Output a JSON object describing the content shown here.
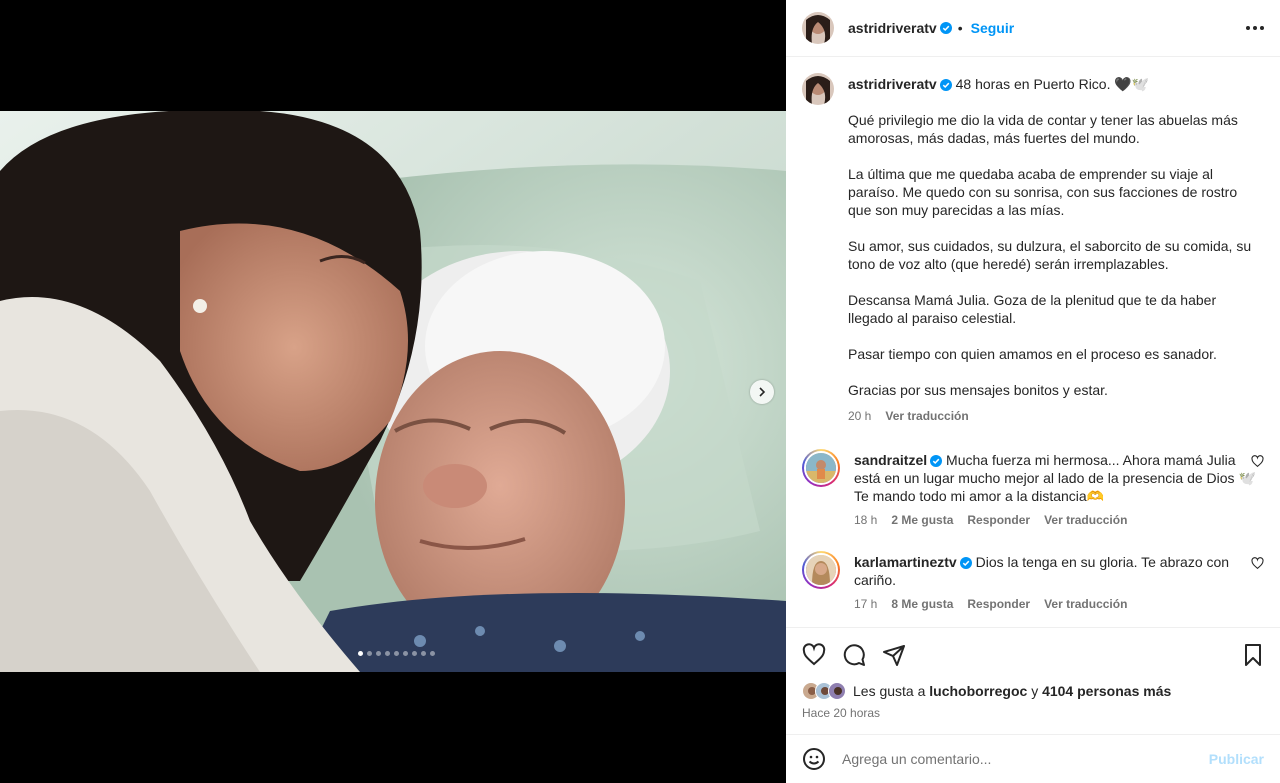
{
  "post": {
    "author": "astridriveratv",
    "follow_label": "Seguir",
    "separator": "•",
    "caption_lines": [
      "48 horas en Puerto Rico. 🖤🕊️",
      "Qué privilegio me dio la vida de contar y tener las abuelas más amorosas, más dadas, más fuertes del mundo.",
      "La última que me quedaba acaba de emprender su viaje al paraíso. Me quedo con su sonrisa, con sus facciones de rostro que son muy parecidas a las mías.",
      "Su amor, sus cuidados, su dulzura, el saborcito de su comida, su tono de voz alto (que heredé) serán irremplazables.",
      "Descansa Mamá Julia. Goza de la plenitud que te da haber llegado al paraiso celestial.",
      "Pasar tiempo con quien amamos en el proceso es sanador.",
      "Gracias por sus mensajes bonitos y estar."
    ],
    "caption_time": "20 h",
    "translate_label": "Ver traducción"
  },
  "comments": [
    {
      "user": "sandraitzel",
      "text": "Mucha fuerza mi hermosa... Ahora mamá Julia está en un lugar mucho mejor al lado de la presencia de Dios 🕊️ Te mando todo mi amor a la distancia🫶",
      "time": "18 h",
      "likes": "2 Me gusta",
      "reply": "Responder",
      "translate": "Ver traducción"
    },
    {
      "user": "karlamartineztv",
      "text": "Dios la tenga en su gloria. Te abrazo con cariño.",
      "time": "17 h",
      "likes": "8 Me gusta",
      "reply": "Responder",
      "translate": "Ver traducción"
    }
  ],
  "engagement": {
    "likes_prefix": "Les gusta a",
    "liked_by": "luchoborregoc",
    "likes_joiner": "y",
    "others": "4104 personas más",
    "posted": "Hace 20 horas"
  },
  "composer": {
    "placeholder": "Agrega un comentario...",
    "publish": "Publicar"
  },
  "carousel": {
    "slide_count": 9,
    "active_index": 0
  },
  "colors": {
    "accent": "#0095f6",
    "muted": "#737373",
    "publish_disabled": "#b2dffc"
  },
  "icons": [
    "heart-icon",
    "comment-icon",
    "share-icon",
    "bookmark-icon",
    "emoji-icon",
    "more-icon",
    "next-arrow-icon",
    "verified-icon"
  ]
}
